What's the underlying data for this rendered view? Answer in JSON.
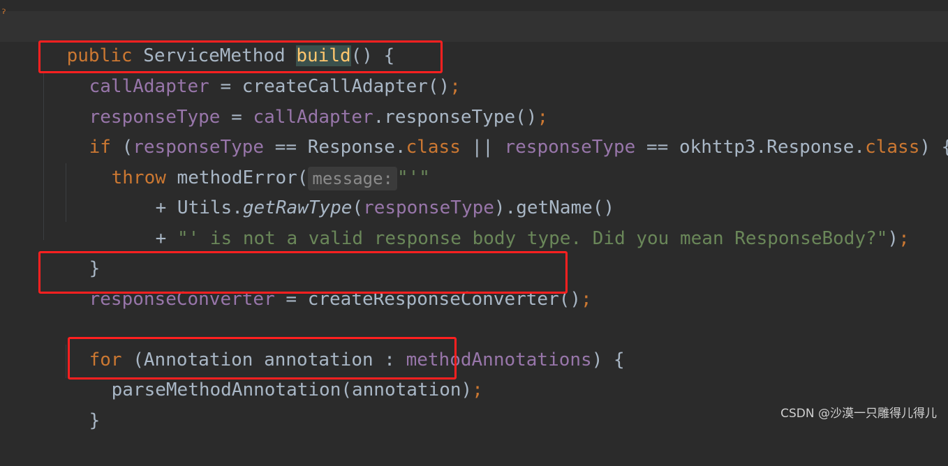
{
  "code": {
    "line1": {
      "kw": "public",
      "type": " ServiceMethod ",
      "fn": "build",
      "rest": "() {"
    },
    "line2": {
      "field": "callAdapter",
      "op": " = ",
      "call": "createCallAdapter()",
      "semi": ";"
    },
    "line3": {
      "field": "responseType",
      "op": " = ",
      "field2": "callAdapter",
      "call": ".responseType()",
      "semi": ";"
    },
    "line4": {
      "kw": "if",
      "p1": " (",
      "field": "responseType",
      "p2": " == Response.",
      "kw2": "class",
      "p3": " || ",
      "field2": "responseType",
      "p4": " == okhttp3.Response.",
      "kw3": "class",
      "p5": ") {"
    },
    "line5": {
      "kw": "throw",
      "call": " methodError(",
      "hint": "message:",
      "str": "\"'\""
    },
    "line6": {
      "p1": "+ Utils.",
      "fn": "getRawType",
      "p2": "(",
      "field": "responseType",
      "p3": ").getName()"
    },
    "line7": {
      "p1": "+ ",
      "str": "\"' is not a valid response body type. Did you mean ResponseBody?\"",
      "p2": ")",
      "semi": ";"
    },
    "line8": {
      "text": "}"
    },
    "line9": {
      "field": "responseConverter",
      "op": " = ",
      "call": "createResponseConverter()",
      "semi": ";"
    },
    "line11": {
      "kw": "for",
      "p1": " (Annotation annotation : ",
      "field": "methodAnnotations",
      "p2": ") {"
    },
    "line12": {
      "call": "parseMethodAnnotation(annotation)",
      "semi": ";"
    },
    "line13": {
      "text": "}"
    }
  },
  "watermark": "CSDN @沙漠一只雕得儿得儿",
  "colors": {
    "keyword": "#cc7832",
    "field": "#9876aa",
    "method": "#ffc66d",
    "string": "#6a8759",
    "text": "#a9b7c6",
    "background": "#2b2b2b",
    "highlight_box": "#ff2020"
  }
}
